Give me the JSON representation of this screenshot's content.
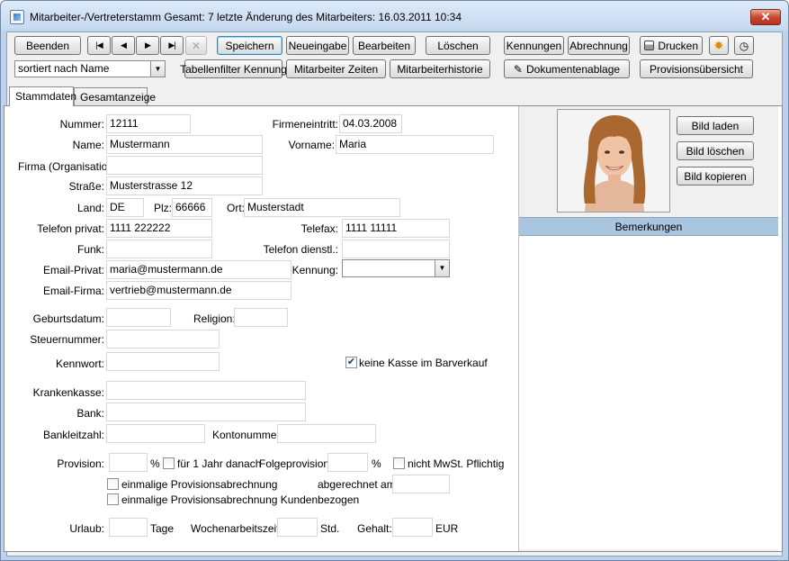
{
  "window": {
    "title": "Mitarbeiter-/Vertreterstamm   Gesamt: 7   letzte Änderung des Mitarbeiters: 16.03.2011 10:34",
    "close": "✕"
  },
  "toolbar": {
    "beenden": "Beenden",
    "nav_first": "|◀",
    "nav_prev": "◀",
    "nav_next": "▶",
    "nav_last": "▶|",
    "nav_cancel": "✕",
    "speichern": "Speichern",
    "neueingabe": "Neueingabe",
    "bearbeiten": "Bearbeiten",
    "loeschen": "Löschen",
    "kennungen": "Kennungen",
    "abrechnung": "Abrechnung",
    "drucken": "Drucken",
    "sort_value": "sortiert nach Name",
    "tabellenfilter": "Tabellenfilter Kennung",
    "mitarbeiter_zeiten": "Mitarbeiter Zeiten",
    "mitarbeiterhistorie": "Mitarbeiterhistorie",
    "dokumentenablage": "Dokumentenablage",
    "provisionsuebersicht": "Provisionsübersicht"
  },
  "tabs": [
    "Stammdaten",
    "Gesamtanzeige"
  ],
  "form": {
    "nummer_label": "Nummer:",
    "nummer": "12111",
    "firmeneintritt_label": "Firmeneintritt:",
    "firmeneintritt": "04.03.2008",
    "name_label": "Name:",
    "name": "Mustermann",
    "vorname_label": "Vorname:",
    "vorname": "Maria",
    "firma_label": "Firma (Organisation):",
    "firma": "",
    "strasse_label": "Straße:",
    "strasse": "Musterstrasse 12",
    "land_label": "Land:",
    "land": "DE",
    "plz_label": "Plz:",
    "plz": "66666",
    "ort_label": "Ort:",
    "ort": "Musterstadt",
    "telefon_privat_label": "Telefon privat:",
    "telefon_privat": "1111 222222",
    "telefax_label": "Telefax:",
    "telefax": "1111 11111",
    "funk_label": "Funk:",
    "funk": "",
    "telefon_dienstl_label": "Telefon dienstl.:",
    "telefon_dienstl": "",
    "email_privat_label": "Email-Privat:",
    "email_privat": "maria@mustermann.de",
    "kennung_label": "Kennung:",
    "kennung": "",
    "email_firma_label": "Email-Firma:",
    "email_firma": "vertrieb@mustermann.de",
    "geburtsdatum_label": "Geburtsdatum:",
    "geburtsdatum": "",
    "religion_label": "Religion:",
    "religion": "",
    "steuernummer_label": "Steuernummer:",
    "steuernummer": "",
    "kennwort_label": "Kennwort:",
    "kennwort": "",
    "keine_kasse_label": "keine Kasse im Barverkauf",
    "keine_kasse_checked": "✔",
    "krankenkasse_label": "Krankenkasse:",
    "krankenkasse": "",
    "bank_label": "Bank:",
    "bank": "",
    "bankleitzahl_label": "Bankleitzahl:",
    "bankleitzahl": "",
    "kontonummer_label": "Kontonummer:",
    "kontonummer": "",
    "provision_label": "Provision:",
    "provision": "",
    "percent": "%",
    "ein_jahr_label": "für 1 Jahr danach",
    "folgeprovision_label": "Folgeprovision:",
    "folgeprovision": "",
    "nicht_mwst_label": "nicht MwSt. Pflichtig",
    "einmalige_label": "einmalige Provisionsabrechnung",
    "abgerechnet_label": "abgerechnet am:",
    "abgerechnet": "",
    "einmalige_kunden_label": "einmalige Provisionsabrechnung Kundenbezogen",
    "urlaub_label": "Urlaub:",
    "urlaub": "",
    "tage": "Tage",
    "wochenarbeitszeit_label": "Wochenarbeitszeit:",
    "wochenarbeitszeit": "",
    "std": "Std.",
    "gehalt_label": "Gehalt:",
    "gehalt": "",
    "eur": "EUR"
  },
  "photo_panel": {
    "bild_laden": "Bild laden",
    "bild_loeschen": "Bild löschen",
    "bild_kopieren": "Bild kopieren",
    "bemerkungen": "Bemerkungen"
  },
  "colors": {
    "titlebar": "#c8dbf0",
    "header_strip": "#a9c5e0",
    "close_button": "#c8472f"
  }
}
